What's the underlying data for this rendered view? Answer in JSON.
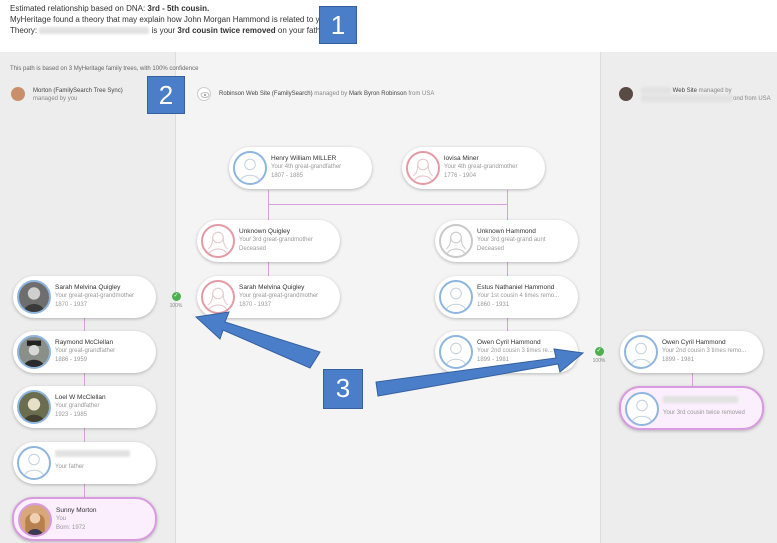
{
  "header": {
    "line1_prefix": "Estimated relationship based on DNA:",
    "line1_bold": "3rd - 5th cousin.",
    "line2": "MyHeritage found a theory that may explain how John Morgan Hammond is related to you.",
    "line3_prefix": "Theory:",
    "line3_mid": "is your",
    "line3_bold": "3rd cousin twice removed",
    "line3_suffix": "on your father's side"
  },
  "callouts": {
    "one": "1",
    "two": "2",
    "three": "3"
  },
  "basis": "This path is based on 3 MyHeritage family trees, with 100% confidence",
  "trees": {
    "left": {
      "title": "Morton (FamilySearch Tree Sync)",
      "managed": "managed by you"
    },
    "middle": {
      "title": "Robinson Web Site (FamilySearch)",
      "managed_prefix": "managed by",
      "manager": "Mark Byron Robinson",
      "from": "from USA"
    },
    "right": {
      "title": "Web Site",
      "managed": "managed by",
      "from": "ond from USA"
    }
  },
  "cards": {
    "henry": {
      "name": "Henry William MILLER",
      "rel": "Your 4th great-grandfather",
      "yrs": "1807 - 1885"
    },
    "lovisa": {
      "name": "lovisa Miner",
      "rel": "Your 4th great-grandmother",
      "yrs": "1776 - 1904"
    },
    "unk_quigley": {
      "name": "Unknown Quigley",
      "rel": "Your 3rd great-grandmother",
      "yrs": "Deceased"
    },
    "unk_hammond": {
      "name": "Unknown Hammond",
      "rel": "Your 3rd great-grand aunt",
      "yrs": "Deceased"
    },
    "sarah_left": {
      "name": "Sarah Melvina Quigley",
      "rel": "Your great-great-grandmother",
      "yrs": "1870 - 1937"
    },
    "sarah_mid": {
      "name": "Sarah Melvina Quigley",
      "rel": "Your great-great-grandmother",
      "yrs": "1870 - 1937"
    },
    "estus": {
      "name": "Estus Nathaniel Hammond",
      "rel": "Your 1st cousin 4 times remo...",
      "yrs": "1860 - 1931"
    },
    "raymond": {
      "name": "Raymond McClellan",
      "rel": "Your great-grandfather",
      "yrs": "1886 - 1959"
    },
    "owen_mid": {
      "name": "Owen Cyril Hammond",
      "rel": "Your 2nd cousin 3 times re...",
      "yrs": "1899 - 1981"
    },
    "owen_right": {
      "name": "Owen Cyril Hammond",
      "rel": "Your 2nd cousin 3 times remo...",
      "yrs": "1899 - 1981"
    },
    "loel": {
      "name": "Loel W McClellan",
      "rel": "Your grandfather",
      "yrs": "1923 - 1985"
    },
    "father": {
      "rel": "Your father"
    },
    "cousin": {
      "rel": "Your 3rd cousin twice removed"
    },
    "sunny": {
      "name": "Sunny Morton",
      "rel": "You",
      "yrs": "Born: 1972"
    }
  },
  "matches": {
    "left": "100%",
    "right": "100%"
  },
  "colors": {
    "callout": "#4a7ec9",
    "connector": "#d9a0df",
    "highlight": "#d99be0",
    "match_green": "#4caf50"
  }
}
